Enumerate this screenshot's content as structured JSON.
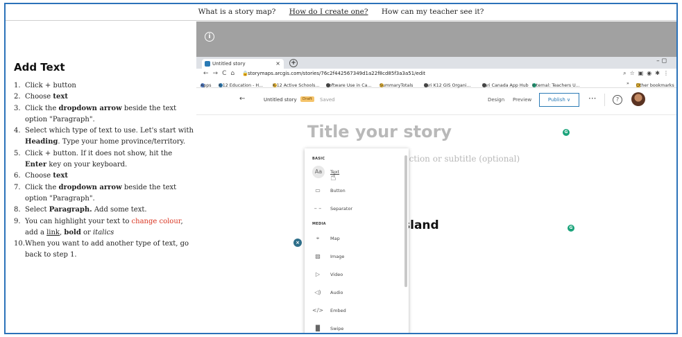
{
  "topnav": {
    "links": [
      "What is a story map?",
      "How do I create one?",
      "How can my teacher see it?"
    ]
  },
  "instructions": {
    "heading": "Add Text",
    "steps": [
      {
        "n": "1.",
        "html_parts": [
          {
            "t": "Click + button"
          }
        ]
      },
      {
        "n": "2.",
        "html_parts": [
          {
            "t": "Choose "
          },
          {
            "t": "text",
            "b": true
          }
        ]
      },
      {
        "n": "3.",
        "html_parts": [
          {
            "t": "Click the "
          },
          {
            "t": "dropdown arrow",
            "b": true
          },
          {
            "t": " beside the text option \"Paragraph\"."
          }
        ]
      },
      {
        "n": "4.",
        "html_parts": [
          {
            "t": "Select which type of text to use. Let's start with "
          },
          {
            "t": "Heading",
            "b": true
          },
          {
            "t": ". Type your home province/territory."
          }
        ]
      },
      {
        "n": "5.",
        "html_parts": [
          {
            "t": "Click + button. If it does not show, hit the "
          },
          {
            "t": "Enter",
            "b": true
          },
          {
            "t": " key on your keyboard."
          }
        ]
      },
      {
        "n": "6.",
        "html_parts": [
          {
            "t": "Choose "
          },
          {
            "t": "text",
            "b": true
          }
        ]
      },
      {
        "n": "7.",
        "html_parts": [
          {
            "t": "Click the "
          },
          {
            "t": "dropdown arrow",
            "b": true
          },
          {
            "t": " beside the text option \"Paragraph\"."
          }
        ]
      },
      {
        "n": "8.",
        "html_parts": [
          {
            "t": "Select "
          },
          {
            "t": "Paragraph.",
            "b": true
          },
          {
            "t": " Add some text."
          }
        ]
      },
      {
        "n": "9.",
        "html_parts": [
          {
            "t": "You can highlight your text to "
          },
          {
            "t": "change colour",
            "red": true
          },
          {
            "t": ", add a "
          },
          {
            "t": "link",
            "u": true
          },
          {
            "t": ", "
          },
          {
            "t": "bold",
            "b": true
          },
          {
            "t": " or "
          },
          {
            "t": "italics",
            "i": true
          }
        ]
      },
      {
        "n": "10.",
        "html_parts": [
          {
            "t": "When you want to add another type of text, go back to step 1."
          }
        ]
      }
    ]
  },
  "browser": {
    "tab_title": "Untitled story",
    "tab_close": "×",
    "new_tab": "+",
    "window_controls": "–   ◻",
    "url": "storymaps.arcgis.com/stories/76c2f442567349d1a22f8cd85f3a3a51/edit",
    "bookmarks": [
      "Apps",
      "K-12 Education - H...",
      "K-12 Active Schools...",
      "Software Use in Ca...",
      "SummaryTotals",
      "Esri K12 GIS Organi...",
      "Esri Canada App Hub",
      "Internal: Teachers U...",
      "»",
      "Other bookmarks"
    ]
  },
  "editor": {
    "back": "←",
    "story_title": "Untitled story",
    "draft_badge": "Draft",
    "saved": "Saved",
    "design": "Design",
    "preview": "Preview",
    "publish": "Publish ∨",
    "more": "···",
    "help": "?",
    "title_placeholder": "Title your story",
    "subtitle_placeholder": "luction or subtitle (optional)",
    "heading_text": "sland",
    "close": "×",
    "grammarly": "G"
  },
  "block_menu": {
    "basic_label": "BASIC",
    "media_label": "MEDIA",
    "basic_items": [
      {
        "label": "Text",
        "icon": "text-icon",
        "glyph": "Aa"
      },
      {
        "label": "Button",
        "icon": "button-icon",
        "glyph": "▭"
      },
      {
        "label": "Separator",
        "icon": "separator-icon",
        "glyph": "– –"
      }
    ],
    "media_items": [
      {
        "label": "Map",
        "icon": "map-pin-icon",
        "glyph": "⌖"
      },
      {
        "label": "Image",
        "icon": "image-icon",
        "glyph": "▨"
      },
      {
        "label": "Video",
        "icon": "video-icon",
        "glyph": "▷"
      },
      {
        "label": "Audio",
        "icon": "audio-icon",
        "glyph": "◁)"
      },
      {
        "label": "Embed",
        "icon": "embed-icon",
        "glyph": "</>"
      },
      {
        "label": "Swipe",
        "icon": "swipe-icon",
        "glyph": "▐▌"
      }
    ]
  },
  "colors": {
    "frame_border": "#2b72b9",
    "red_text": "#d9331f",
    "accent": "#2a7ab5",
    "grammarly": "#1aa37a"
  }
}
